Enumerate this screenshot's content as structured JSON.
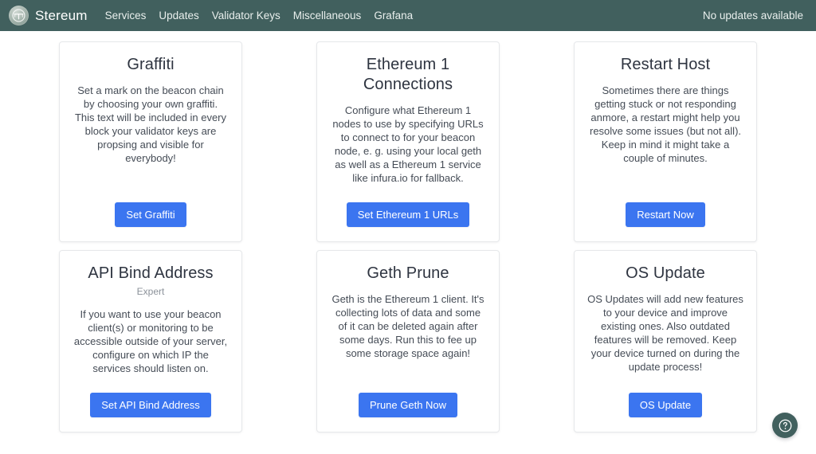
{
  "header": {
    "brand": "Stereum",
    "logo_icon": "stereum-logo-icon",
    "nav": [
      {
        "label": "Services"
      },
      {
        "label": "Updates"
      },
      {
        "label": "Validator Keys"
      },
      {
        "label": "Miscellaneous"
      },
      {
        "label": "Grafana"
      }
    ],
    "status": "No updates available",
    "background_color": "#41605e",
    "text_color": "#e9efed"
  },
  "page": {
    "background_color": "#ffffff",
    "accent_color": "#3b75f0"
  },
  "cards": [
    {
      "id": "graffiti",
      "title": "Graffiti",
      "subtitle": "",
      "description": "Set a mark on the beacon chain by choosing your own graffiti. This text will be included in every block your validator keys are propsing and visible for everybody!",
      "button": "Set Graffiti"
    },
    {
      "id": "ethereum-1-connections",
      "title": "Ethereum 1 Connections",
      "subtitle": "",
      "description": "Configure what Ethereum 1 nodes to use by specifying URLs to connect to for your beacon node, e. g. using your local geth as well as a Ethereum 1 service like infura.io for fallback.",
      "button": "Set Ethereum 1 URLs"
    },
    {
      "id": "restart-host",
      "title": "Restart Host",
      "subtitle": "",
      "description": "Sometimes there are things getting stuck or not responding anmore, a restart might help you resolve some issues (but not all). Keep in mind it might take a couple of minutes.",
      "button": "Restart Now"
    },
    {
      "id": "api-bind-address",
      "title": "API Bind Address",
      "subtitle": "Expert",
      "description": "If you want to use your beacon client(s) or monitoring to be accessible outside of your server, configure on which IP the services should listen on.",
      "button": "Set API Bind Address"
    },
    {
      "id": "geth-prune",
      "title": "Geth Prune",
      "subtitle": "",
      "description": "Geth is the Ethereum 1 client. It's collecting lots of data and some of it can be deleted again after some days. Run this to fee up some storage space again!",
      "button": "Prune Geth Now"
    },
    {
      "id": "os-update",
      "title": "OS Update",
      "subtitle": "",
      "description": "OS Updates will add new features to your device and improve existing ones. Also outdated features will be removed. Keep your device turned on during the update process!",
      "button": "OS Update"
    }
  ],
  "help_button": {
    "icon": "question-mark-circle-icon",
    "label": "Help"
  }
}
